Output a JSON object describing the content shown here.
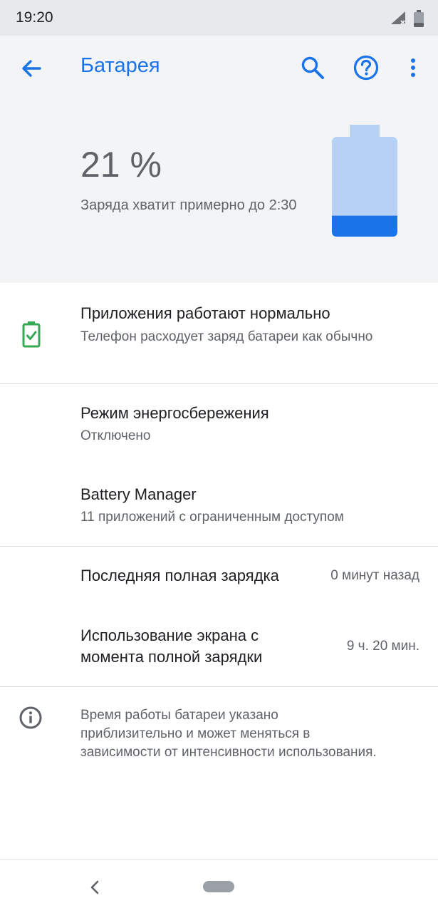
{
  "status_bar": {
    "time": "19:20",
    "icons": [
      "signal-icon",
      "battery-icon"
    ]
  },
  "app_bar": {
    "title": "Батарея",
    "back_icon": "arrow-back-icon",
    "search_icon": "search-icon",
    "help_icon": "help-icon",
    "more_icon": "more-vert-icon",
    "accent_color": "#1a73e8"
  },
  "battery": {
    "percent_text": "21 %",
    "percent_value": 21,
    "estimate": "Заряда хватит примерно до 2:30",
    "fill_color": "#1a73e8",
    "empty_color": "#b6d1f4"
  },
  "items": {
    "apps_status": {
      "title": "Приложения работают нормально",
      "subtitle": "Телефон расходует заряд батареи как обычно",
      "icon": "battery-check-icon",
      "icon_color": "#34a853"
    },
    "power_saver": {
      "title": "Режим энергосбережения",
      "subtitle": "Отключено"
    },
    "battery_manager": {
      "title": "Battery Manager",
      "subtitle": "11 приложений с ограниченным доступом"
    },
    "last_charge": {
      "title": "Последняя полная зарядка",
      "value": "0 минут назад"
    },
    "screen_usage": {
      "title_line1": "Использование экрана с",
      "title_line2": "момента полной зарядки",
      "value": "9 ч. 20 мин."
    }
  },
  "footer_info": {
    "icon": "info-icon",
    "text": "Время работы батареи указано приблизительно и может меняться в зависимости от интенсивности использования."
  },
  "nav_bar": {
    "back_icon": "nav-back-icon",
    "home_icon": "home-pill-icon"
  }
}
